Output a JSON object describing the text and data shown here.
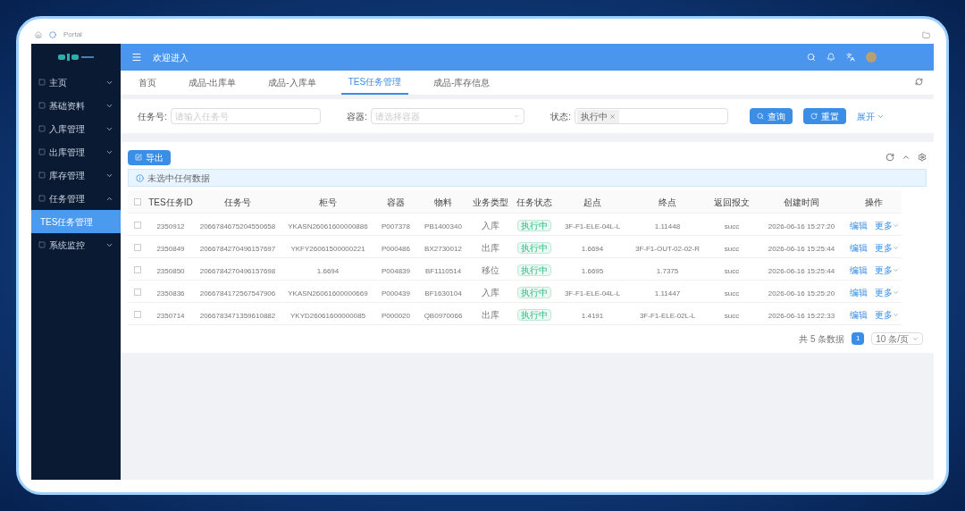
{
  "browser_bar": {
    "tab": "Portal"
  },
  "sidebar": {
    "items": [
      {
        "label": "主页",
        "expanded": false
      },
      {
        "label": "基础资料",
        "expanded": false
      },
      {
        "label": "入库管理",
        "expanded": false
      },
      {
        "label": "出库管理",
        "expanded": false
      },
      {
        "label": "库存管理",
        "expanded": false
      },
      {
        "label": "任务管理",
        "expanded": true,
        "children": [
          {
            "label": "TES任务管理",
            "selected": true
          }
        ]
      },
      {
        "label": "系统监控",
        "expanded": false
      }
    ]
  },
  "header": {
    "title": "欢迎进入"
  },
  "tabs": [
    {
      "label": "首页",
      "selected": false
    },
    {
      "label": "成品-出库单",
      "selected": false
    },
    {
      "label": "成品-入库单",
      "selected": false
    },
    {
      "label": "TES任务管理",
      "selected": true
    },
    {
      "label": "成品-库存信息",
      "selected": false
    }
  ],
  "filters": [
    {
      "label": "任务号:",
      "placeholder": "请输入任务号",
      "kind": "input"
    },
    {
      "label": "容器:",
      "placeholder": "请选择容器",
      "kind": "select"
    },
    {
      "label": "状态:",
      "tags": [
        "执行中"
      ],
      "kind": "tags"
    }
  ],
  "filter_buttons": {
    "search": "查询",
    "reset": "重置",
    "expand": "展开"
  },
  "toolbar": {
    "export": "导出"
  },
  "alert": "未选中任何数据",
  "table": {
    "all_checked": false,
    "columns": [
      "TES任务ID",
      "任务号",
      "柜号",
      "容器",
      "物料",
      "业务类型",
      "任务状态",
      "起点",
      "终点",
      "返回报文",
      "创建时间",
      "操作"
    ],
    "rows": [
      {
        "checked": false,
        "cells": [
          "2350912",
          "2066784675204550658",
          "YKASN26061600000886",
          "P007378",
          "PB1400340",
          "入库",
          "执行中",
          "3F-F1-ELE-04L-L",
          "1.11448",
          "succ",
          "2026-06-16 15:27:20"
        ],
        "actions": [
          "编辑",
          "更多"
        ]
      },
      {
        "checked": false,
        "cells": [
          "2350849",
          "2066784270496157697",
          "YKFY26061500000221",
          "P000486",
          "BX2730012",
          "出库",
          "执行中",
          "1.6694",
          "3F-F1-OUT-02-02-R",
          "succ",
          "2026-06-16 15:25:44"
        ],
        "actions": [
          "编辑",
          "更多"
        ]
      },
      {
        "checked": false,
        "cells": [
          "2350850",
          "2066784270496157698",
          "1.6694",
          "P004839",
          "BF1110514",
          "移位",
          "执行中",
          "1.6695",
          "1.7375",
          "succ",
          "2026-06-16 15:25:44"
        ],
        "actions": [
          "编辑",
          "更多"
        ]
      },
      {
        "checked": false,
        "cells": [
          "2350836",
          "2066784172567547906",
          "YKASN26061600000669",
          "P000439",
          "BF1630104",
          "入库",
          "执行中",
          "3F-F1-ELE-04L-L",
          "1.11447",
          "succ",
          "2026-06-16 15:25:20"
        ],
        "actions": [
          "编辑",
          "更多"
        ]
      },
      {
        "checked": false,
        "cells": [
          "2350714",
          "2066783471359610882",
          "YKYD26061600000085",
          "P000020",
          "QB0970066",
          "出库",
          "执行中",
          "1.4191",
          "3F-F1-ELE-02L-L",
          "succ",
          "2026-06-16 15:22:33"
        ],
        "actions": [
          "编辑",
          "更多"
        ]
      }
    ]
  },
  "pagination": {
    "total": "共 5 条数据",
    "pages": [
      {
        "label": "1",
        "selected": true
      }
    ],
    "page_size": "10 条/页"
  }
}
